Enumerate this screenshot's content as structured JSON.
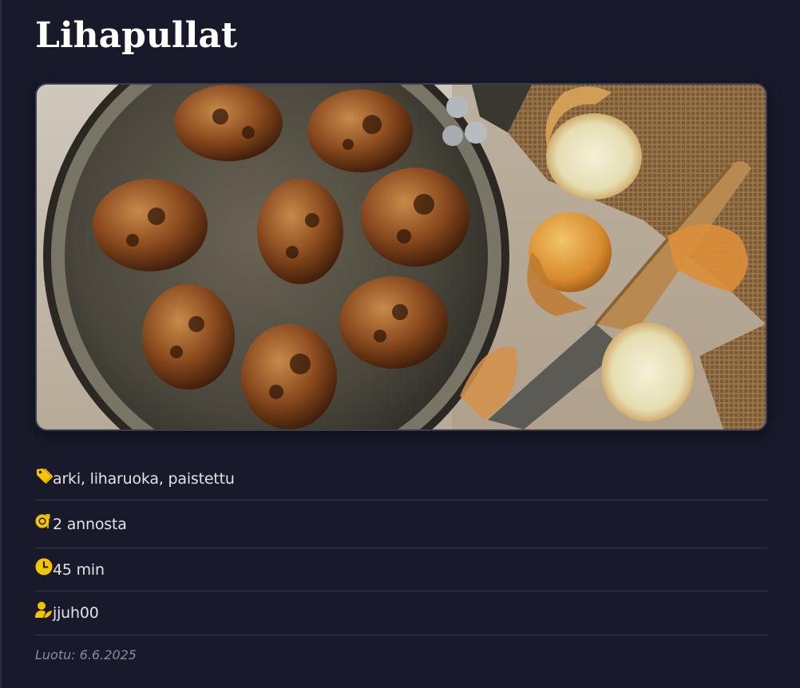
{
  "recipe": {
    "title": "Lihapullat",
    "image_alt": "Lihapullat paistinpannussa",
    "tags": "arki, liharuoka, paistettu",
    "servings": "2 annosta",
    "time": "45 min",
    "author": "jjuh00",
    "created": "Luotu: 6.6.2025"
  },
  "icons": {
    "tags": "tag-icon",
    "servings": "plate-utensils-icon",
    "time": "clock-icon",
    "author": "user-chef-icon"
  },
  "colors": {
    "background": "#181a2c",
    "accent": "#f5c400",
    "divider": "#34364a"
  }
}
